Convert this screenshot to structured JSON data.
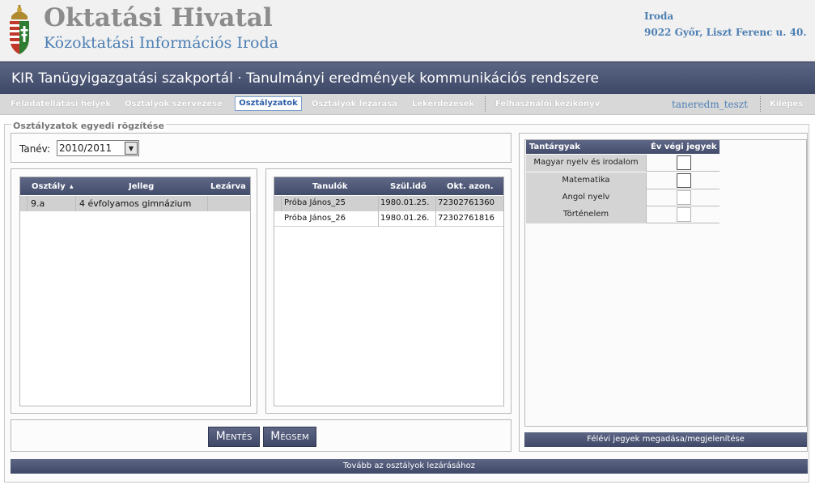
{
  "header": {
    "org_title": "Oktatási Hivatal",
    "org_subtitle": "Közoktatási Információs Iroda",
    "address_line1": "Iroda",
    "address_line2": "9022 Győr, Liszt Ferenc u. 40."
  },
  "titlebar": {
    "text": "KIR Tanügyigazgatási szakportál · Tanulmányi eredmények kommunikációs rendszere"
  },
  "nav": {
    "items": [
      {
        "label": "Feladatellátási helyek"
      },
      {
        "label": "Osztályok szervezése"
      },
      {
        "label": "Osztályzatok",
        "active": true
      },
      {
        "label": "Osztályok lezárása"
      },
      {
        "label": "Lekérdezések"
      },
      {
        "label": "Felhasználói kézikönyv"
      }
    ],
    "user": "taneredm_teszt",
    "logout": "Kilépés"
  },
  "section": {
    "title": "Osztályzatok egyedi rögzítése",
    "year_label": "Tanév:",
    "year_value": "2010/2011"
  },
  "classes": {
    "headers": {
      "class": "Osztály",
      "type": "Jelleg",
      "closed": "Lezárva"
    },
    "sort_indicator": "▲",
    "rows": [
      {
        "class": "9.a",
        "type": "4 évfolyamos gimnázium",
        "closed": ""
      }
    ]
  },
  "students": {
    "headers": {
      "name": "Tanulók",
      "birth": "Szül.idő",
      "id": "Okt. azon."
    },
    "rows": [
      {
        "name": "Próba János_25",
        "birth": "1980.01.25.",
        "id": "72302761360"
      },
      {
        "name": "Próba János_26",
        "birth": "1980.01.26.",
        "id": "72302761816"
      }
    ]
  },
  "buttons": {
    "save": "Mentés",
    "cancel": "Mégsem",
    "semester": "Félévi jegyek megadása/megjelenítése",
    "next": "Tovább az osztályok lezárásához"
  },
  "subjects": {
    "headers": {
      "subject": "Tantárgyak",
      "grade": "Év végi jegyek"
    },
    "rows": [
      {
        "name": "Magyar nyelv és irodalom"
      },
      {
        "name": "Matematika"
      },
      {
        "name": "Angol nyelv"
      },
      {
        "name": "Történelem"
      }
    ]
  },
  "colors": {
    "brand_blue": "#4d7fb3",
    "header_bar": "#3d4766",
    "accent_border": "#7aa0d0"
  }
}
